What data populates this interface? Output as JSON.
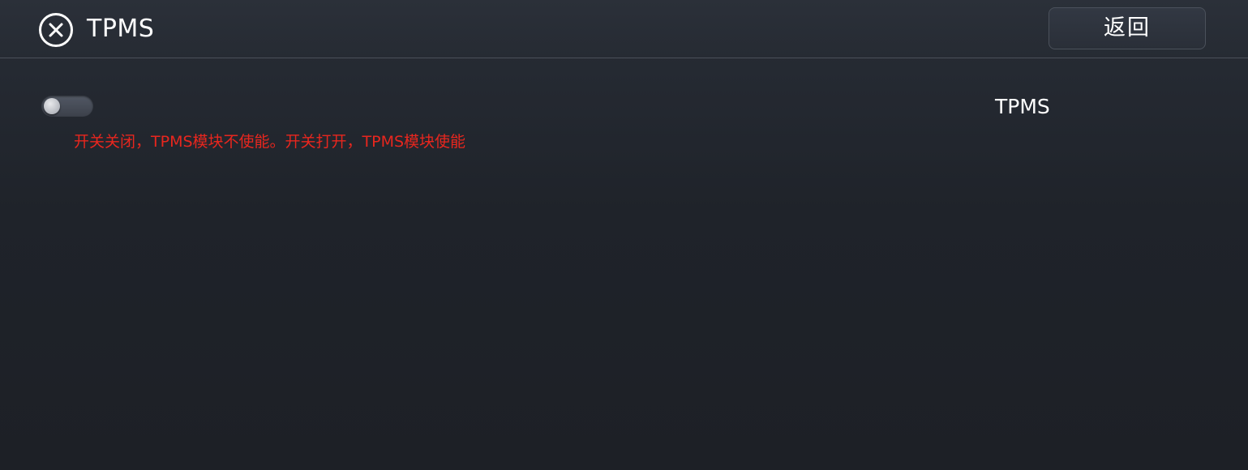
{
  "header": {
    "title": "TPMS",
    "close_icon": "close-circle-icon",
    "back_label": "返回"
  },
  "setting": {
    "label": "TPMS",
    "enabled": false,
    "hint": "开关关闭，TPMS模块不使能。开关打开，TPMS模块使能"
  },
  "colors": {
    "background": "#1f232a",
    "header_background": "#2a2f38",
    "hint_text": "#e8261e",
    "text": "#ffffff"
  }
}
